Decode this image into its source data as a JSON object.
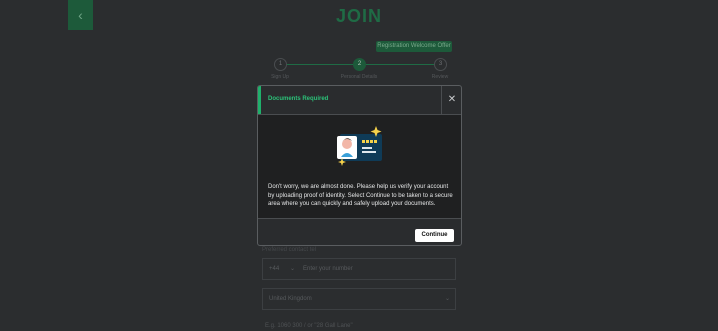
{
  "page": {
    "title": "JOIN",
    "back_icon": "chevron-left-icon",
    "promo_badge": "Registration Welcome Offer"
  },
  "steps": [
    {
      "number": "1",
      "label": "Sign Up",
      "active": false
    },
    {
      "number": "2",
      "label": "Personal Details",
      "active": true
    },
    {
      "number": "3",
      "label": "Review",
      "active": false
    }
  ],
  "form": {
    "phone_label": "Preferred contact tel",
    "phone_prefix": "+44",
    "phone_placeholder": "Enter your number",
    "country_value": "United Kingdom",
    "address_hint": "E.g. 1060 300 / or \"28 Gall Lane\""
  },
  "modal": {
    "title": "Documents Required",
    "close_icon": "close-icon",
    "illustration": "id-card-icon",
    "message": "Don't worry, we are almost done. Please help us verify your account by uploading proof of identity. Select Continue to be taken to a secure area where you can quickly and safely upload your documents.",
    "continue_label": "Continue"
  },
  "colors": {
    "accent": "#1fb06b",
    "accent_dark": "#1d5a3a",
    "overlay_bg": "#2b2d2f",
    "modal_body_bg": "#1f2021",
    "button_bg": "#ffffff"
  }
}
